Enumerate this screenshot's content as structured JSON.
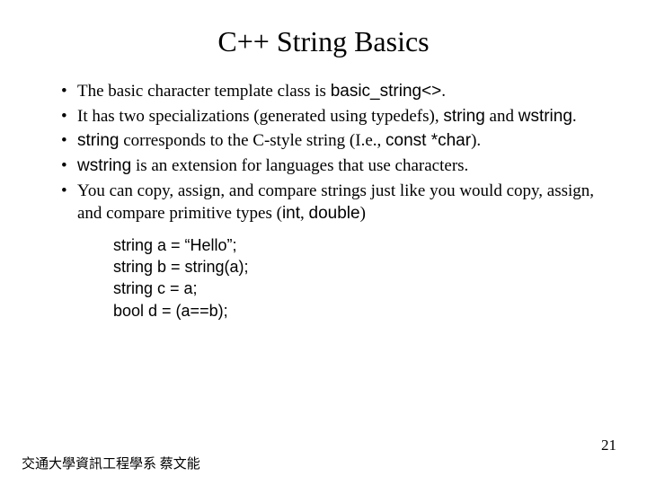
{
  "title": "C++ String Basics",
  "bullets": {
    "b1_a": "The basic character template class is ",
    "b1_code": "basic_string<>",
    "b1_b": ".",
    "b2_a": "It has two specializations (generated using typedefs), ",
    "b2_code1": "string",
    "b2_mid": " and ",
    "b2_code2": "wstring",
    "b2_b": ".",
    "b3_code": "string",
    "b3_a": " corresponds to the C-style string (I.e., ",
    "b3_code2": "const *char",
    "b3_b": ").",
    "b4_code": "wstring",
    "b4_a": " is an extension for languages that use characters.",
    "b5_a": "You can copy, assign, and compare strings just like you would copy, assign, and compare primitive types (",
    "b5_code1": "int",
    "b5_mid": ", ",
    "b5_code2": "double",
    "b5_b": ")"
  },
  "code_lines": {
    "l1": "string a = “Hello”;",
    "l2": "string b = string(a);",
    "l3": "string c = a;",
    "l4": "bool d =  (a==b);"
  },
  "footer_left": "交通大學資訊工程學系 蔡文能",
  "page_number": "21"
}
